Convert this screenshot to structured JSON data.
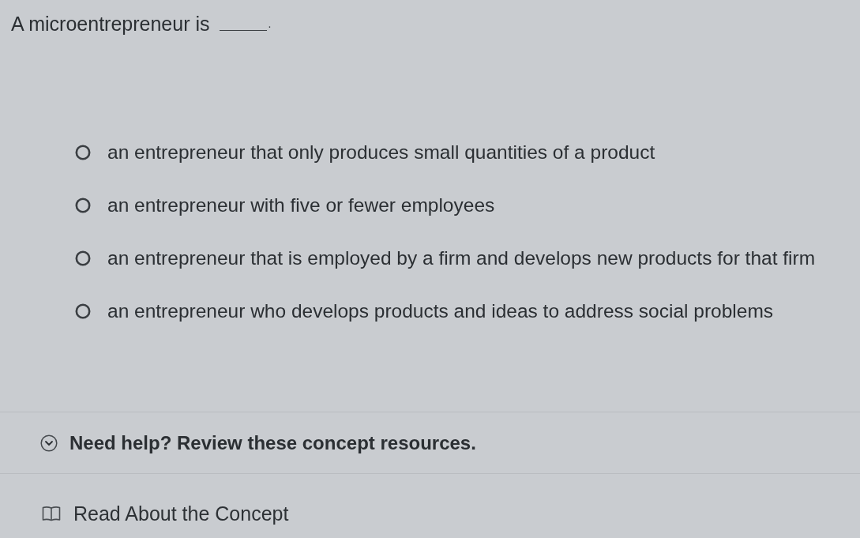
{
  "question": {
    "prompt": "A microentrepreneur is",
    "ending": "."
  },
  "options": [
    {
      "label": "an entrepreneur that only produces small quantities of a product",
      "selected": false
    },
    {
      "label": "an entrepreneur with five or fewer employees",
      "selected": false
    },
    {
      "label": "an entrepreneur that is employed by a firm and develops new products for that firm",
      "selected": false
    },
    {
      "label": "an entrepreneur who develops products and ideas to address social problems",
      "selected": false
    }
  ],
  "help": {
    "label": "Need help? Review these concept resources.",
    "expanded": true,
    "resources": [
      {
        "kind": "reading",
        "label": "Read About the Concept"
      }
    ]
  }
}
